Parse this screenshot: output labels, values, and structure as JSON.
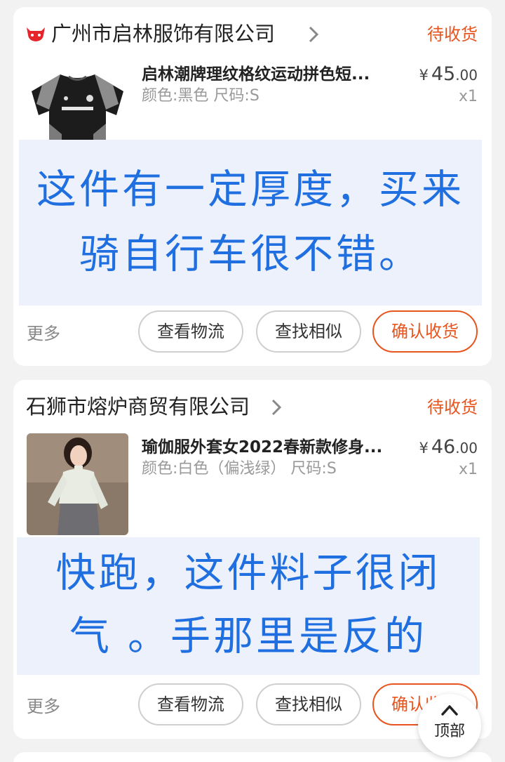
{
  "colors": {
    "page_bg": "#f2f2f2",
    "card_bg": "#ffffff",
    "status_orange": "#e8541e",
    "overlay_bg": "#edf1fb",
    "overlay_text_blue": "#1f6fe0"
  },
  "orders": [
    {
      "shop_name": "广州市启林服饰有限公司",
      "shop_icon": "tmall-cat-icon",
      "status": "待收货",
      "product": {
        "title": "启林潮牌理纹格纹运动拼色短...",
        "spec": "颜色:黑色 尺码:S",
        "price_currency": "¥",
        "price_int": "45",
        "price_dec": ".00",
        "qty": "x1",
        "image": "black-grey-tshirt-image"
      },
      "overlay_lines": [
        "这件有一定厚度，买来",
        "骑自行车很不错。"
      ],
      "more_label": "更多",
      "buttons": {
        "logistics": "查看物流",
        "similar": "查找相似",
        "confirm": "确认收货"
      }
    },
    {
      "shop_name": "石狮市熔炉商贸有限公司",
      "status": "待收货",
      "product": {
        "title": "瑜伽服外套女2022春新款修身...",
        "spec": "颜色:白色（偏浅绿） 尺码:S",
        "price_currency": "¥",
        "price_int": "46",
        "price_dec": ".00",
        "qty": "x1",
        "image": "yoga-jacket-model-photo"
      },
      "overlay_lines": [
        "快跑，这件料子很闭",
        "气 。手那里是反的"
      ],
      "more_label": "更多",
      "buttons": {
        "logistics": "查看物流",
        "similar": "查找相似",
        "confirm": "确认收货"
      }
    }
  ],
  "scroll_top": {
    "label": "顶部",
    "icon": "chevron-up-icon"
  }
}
